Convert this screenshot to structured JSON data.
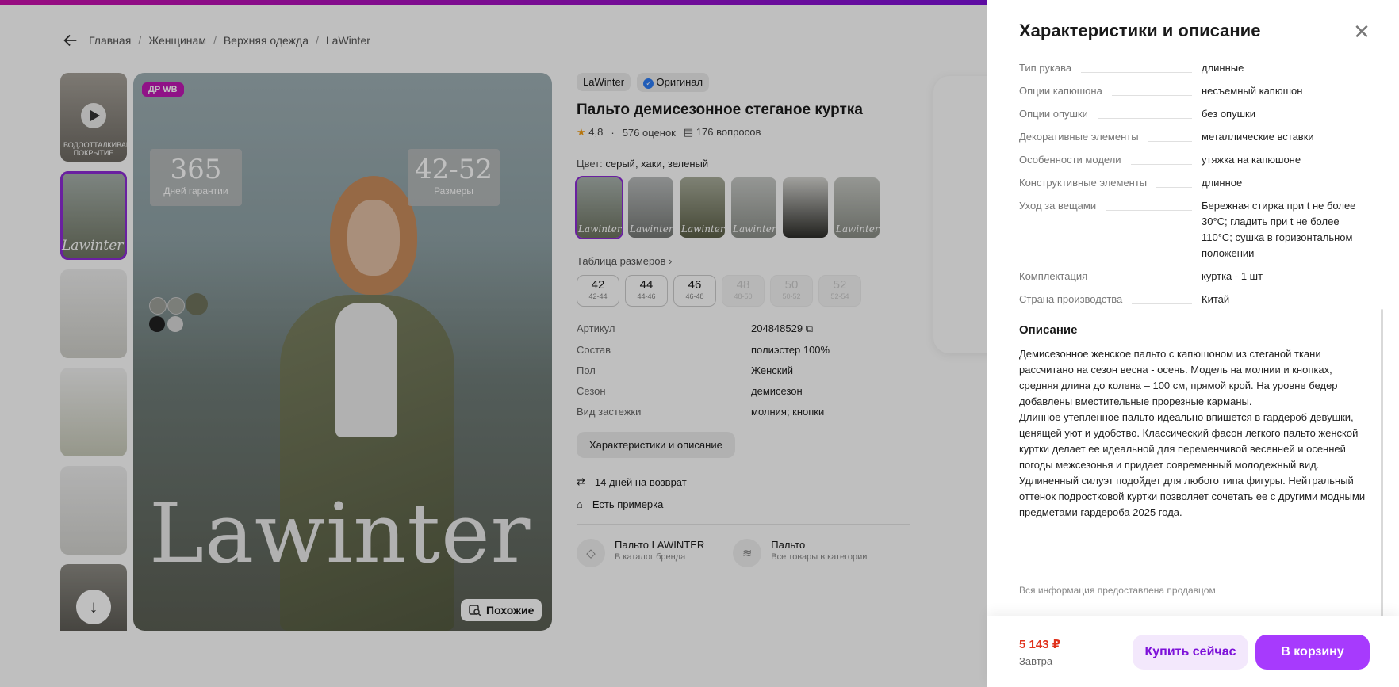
{
  "breadcrumbs": [
    "Главная",
    "Женщинам",
    "Верхняя одежда",
    "LaWinter"
  ],
  "gallery": {
    "badge": "ДР WB",
    "video_caption": "ВОДООТТАЛКИВАЮЩЕЕ ПОКРЫТИЕ",
    "thumb_brand": "Lawinter",
    "warranty_number": "365",
    "warranty_label": "Дней гарантии",
    "sizes_number": "42-52",
    "sizes_label": "Размеры",
    "brand_watermark": "Lawinter",
    "similar_label": "Похожие"
  },
  "product": {
    "brand": "LaWinter",
    "original_label": "Оригинал",
    "title": "Пальто демисезонное стеганое куртка",
    "rating": "4,8",
    "reviews": "576 оценок",
    "questions": "176 вопросов",
    "color_label": "Цвет:",
    "color_value": "серый, хаки, зеленый",
    "size_table_link": "Таблица размеров",
    "sizes": [
      {
        "size": "42",
        "ru": "42-44",
        "available": true
      },
      {
        "size": "44",
        "ru": "44-46",
        "available": true
      },
      {
        "size": "46",
        "ru": "46-48",
        "available": true
      },
      {
        "size": "48",
        "ru": "48-50",
        "available": false
      },
      {
        "size": "50",
        "ru": "50-52",
        "available": false
      },
      {
        "size": "52",
        "ru": "52-54",
        "available": false
      }
    ],
    "specs": [
      {
        "k": "Артикул",
        "v": "204848529"
      },
      {
        "k": "Состав",
        "v": "полиэстер 100%"
      },
      {
        "k": "Пол",
        "v": "Женский"
      },
      {
        "k": "Сезон",
        "v": "демисезон"
      },
      {
        "k": "Вид застежки",
        "v": "молния; кнопки"
      }
    ],
    "details_button": "Характеристики и описание",
    "perk_return": "14 дней на возврат",
    "perk_fitting": "Есть примерка",
    "brand_card_title": "Пальто LAWINTER",
    "brand_card_sub": "В каталог бренда",
    "category_card_title": "Пальто",
    "category_card_sub": "Все товары в категории"
  },
  "colors": {
    "accent": "#a73afd",
    "price": "#e0321c",
    "badge": "#c118b4"
  },
  "panel": {
    "title": "Характеристики и описание",
    "close_icon": "close-icon",
    "props": [
      {
        "k": "Тип рукава",
        "v": "длинные"
      },
      {
        "k": "Опции капюшона",
        "v": "несъемный капюшон"
      },
      {
        "k": "Опции опушки",
        "v": "без опушки"
      },
      {
        "k": "Декоративные элементы",
        "v": "металлические вставки"
      },
      {
        "k": "Особенности модели",
        "v": "утяжка на капюшоне"
      },
      {
        "k": "Конструктивные элементы",
        "v": "длинное"
      },
      {
        "k": "Уход за вещами",
        "v": "Бережная стирка при t не более 30°С; гладить при t не более 110°С; сушка в горизонтальном положении"
      },
      {
        "k": "Комплектация",
        "v": "куртка - 1 шт"
      },
      {
        "k": "Страна производства",
        "v": "Китай"
      }
    ],
    "description_title": "Описание",
    "description": [
      "Демисезонное женское пальто с капюшоном из стеганой ткани рассчитано на сезон весна - осень. Модель на молнии и кнопках, средняя длина до колена – 100 см, прямой крой. На уровне бедер добавлены вместительные прорезные карманы.",
      "Длинное утепленное пальто идеально впишется в гардероб девушки, ценящей уют и удобство. Классический фасон легкого пальто женской куртки делает ее идеальной для переменчивой весенней и осенней погоды межсезонья и придает современный молодежный вид.",
      "Удлиненный силуэт подойдет для любого типа фигуры. Нейтральный оттенок подростковой куртки позволяет сочетать ее с другими модными предметами гардероба 2025 года."
    ],
    "seller_note": "Вся информация предоставлена продавцом"
  },
  "footer": {
    "price": "5 143 ₽",
    "delivery": "Завтра",
    "buy_now": "Купить сейчас",
    "to_cart": "В корзину"
  }
}
